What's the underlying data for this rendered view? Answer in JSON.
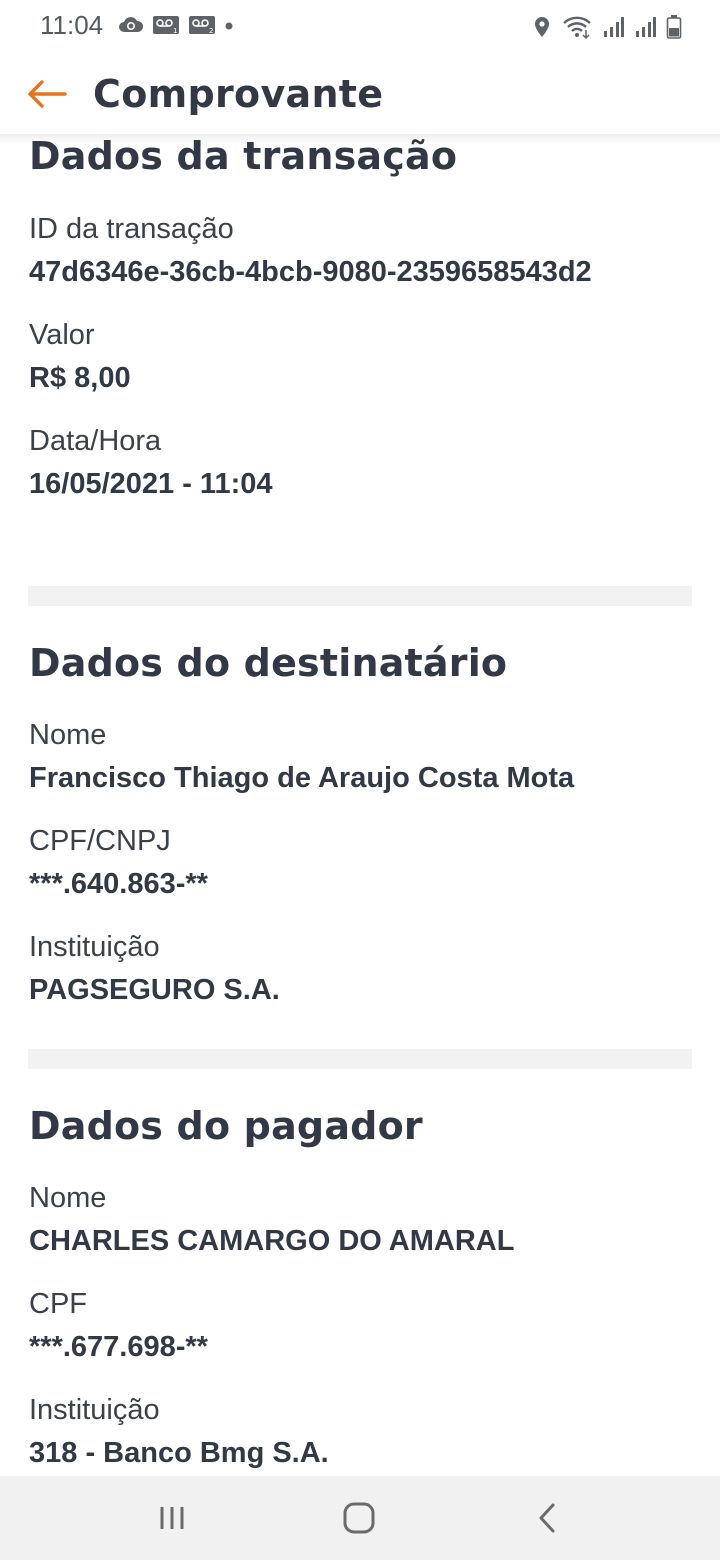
{
  "status_bar": {
    "time": "11:04",
    "left_icons": [
      "sync-cloud-icon",
      "voicemail-1-icon",
      "voicemail-2-icon",
      "dot-icon"
    ],
    "right_icons": [
      "location-icon",
      "wifi-icon",
      "signal-1-icon",
      "signal-2-icon",
      "battery-icon"
    ]
  },
  "app_bar": {
    "title": "Comprovante",
    "back_icon": "arrow-left-icon",
    "accent_color": "#e8731f"
  },
  "transaction": {
    "title": "Dados da transação",
    "id_label": "ID da transação",
    "id_value": "47d6346e-36cb-4bcb-9080-2359658543d2",
    "amount_label": "Valor",
    "amount_value": "R$ 8,00",
    "datetime_label": "Data/Hora",
    "datetime_value": "16/05/2021 - 11:04"
  },
  "recipient": {
    "title": "Dados do destinatário",
    "name_label": "Nome",
    "name_value": "Francisco Thiago de Araujo Costa Mota",
    "doc_label": "CPF/CNPJ",
    "doc_value": "***.640.863-**",
    "institution_label": "Instituição",
    "institution_value": "PAGSEGURO S.A."
  },
  "payer": {
    "title": "Dados do pagador",
    "name_label": "Nome",
    "name_value": "CHARLES CAMARGO DO AMARAL",
    "doc_label": "CPF",
    "doc_value": "***.677.698-**",
    "institution_label": "Instituição",
    "institution_value": "318 - Banco Bmg S.A."
  },
  "nav_bar": {
    "buttons": [
      "recent-apps-icon",
      "home-icon",
      "back-icon"
    ]
  }
}
